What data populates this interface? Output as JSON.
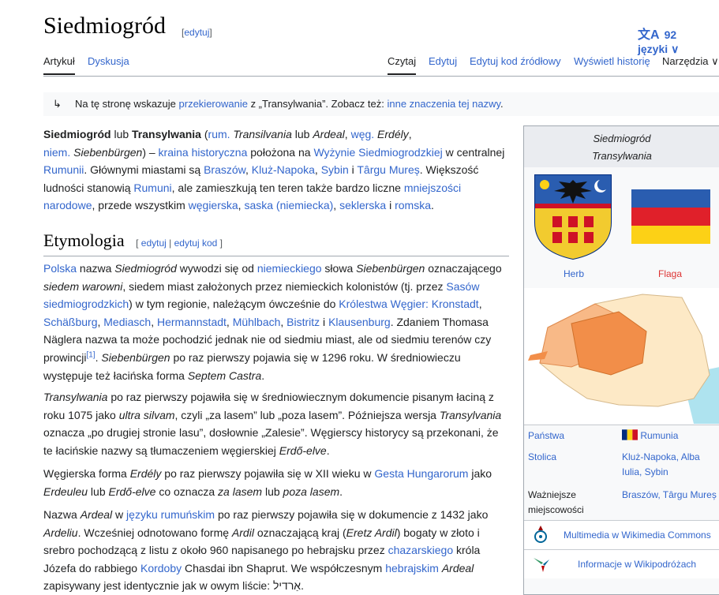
{
  "header": {
    "title": "Siedmiogród",
    "edit_label": "edytuj",
    "languages": "92 języki"
  },
  "tabs": {
    "article": "Artykuł",
    "talk": "Dyskusja",
    "read": "Czytaj",
    "edit": "Edytuj",
    "edit_source": "Edytuj kod źródłowy",
    "history": "Wyświetl historię",
    "tools": "Narzędzia"
  },
  "hatnote": {
    "t1": "Na tę stronę wskazuje ",
    "l1": "przekierowanie",
    "t2": " z „Transylwania”. Zobacz też: ",
    "l2": "inne znaczenia tej nazwy",
    "t3": "."
  },
  "etymology": {
    "heading": "Etymologia",
    "edit": "edytuj",
    "sep": "|",
    "edit_source": "edytuj kod"
  },
  "infobox": {
    "title1": "Siedmiogród",
    "title2": "Transylwania",
    "herb": "Herb",
    "flag": "Flaga",
    "country_label": "Państwa",
    "country_value": "Rumunia",
    "capital_label": "Stolica",
    "capital_value": "Kluż-Napoka, Alba Iulia, Sybin",
    "cities_label": "Ważniejsze miejscowości",
    "cities_value": "Braszów, Târgu Mureș",
    "commons": "Multimedia w Wikimedia Commons",
    "voyage": "Informacje w Wikipodróżach"
  },
  "colors": {
    "link": "#3366cc",
    "red_link": "#d33",
    "flag_blue": "#002b7f",
    "flag_yellow": "#fcd116",
    "flag_red": "#ce1126",
    "map_highlight": "#f59a5a",
    "map_light": "#fde9c6"
  }
}
